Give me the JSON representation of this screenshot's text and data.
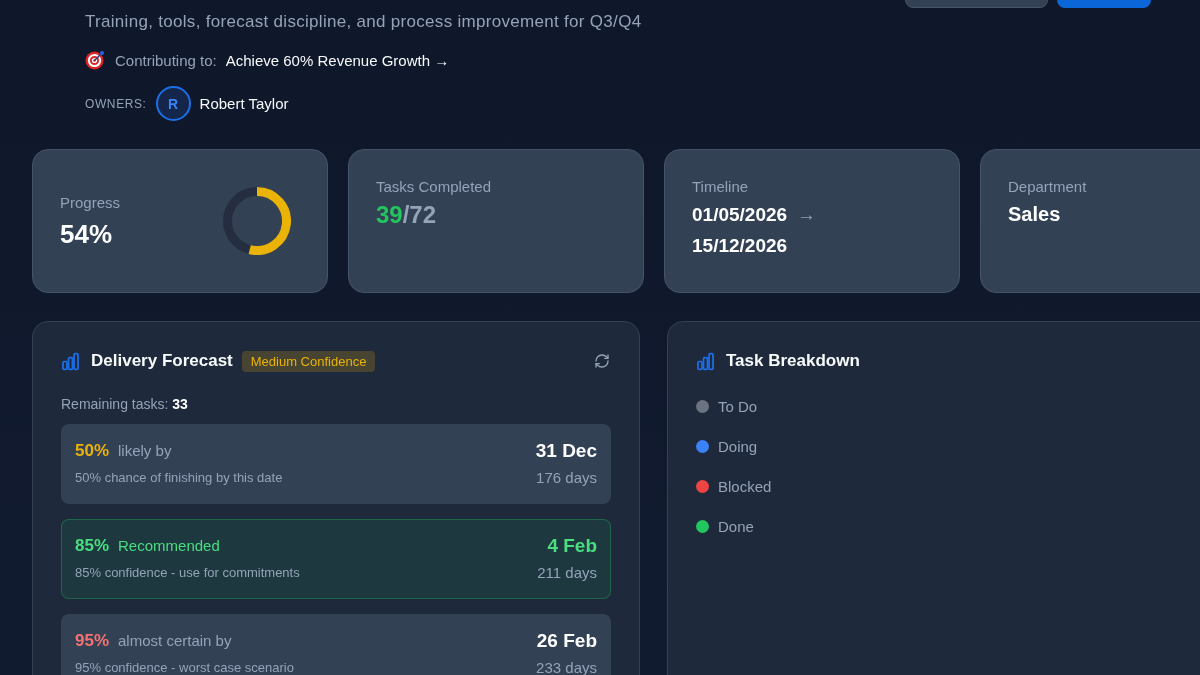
{
  "header_buttons": [
    {
      "kind": "secondary"
    },
    {
      "kind": "primary"
    }
  ],
  "description": "Training, tools, forecast discipline, and process improvement for Q3/Q4",
  "contributing": {
    "label": "Contributing to:",
    "goal": "Achieve 60% Revenue Growth →"
  },
  "owners": {
    "label": "OWNERS:",
    "people": [
      {
        "initial": "R",
        "name": "Robert Taylor"
      }
    ]
  },
  "stats": [
    {
      "kind": "progress",
      "label": "Progress",
      "value": "54%",
      "level": 0.54
    },
    {
      "kind": "fraction",
      "label": "Tasks Completed",
      "done": "39",
      "total": "/72"
    },
    {
      "kind": "range",
      "label": "Timeline",
      "start": "01/05/2026",
      "arrow": "→",
      "end": "15/12/2026"
    },
    {
      "kind": "text",
      "label": "Department",
      "value": "Sales"
    }
  ],
  "forecast": {
    "title": "Delivery Forecast",
    "confidence": "Medium Confidence",
    "remaining": "Remaining tasks: **33**",
    "rows": [
      {
        "percent": "50%",
        "color": "#eab308",
        "label": "likely by",
        "note": "50% chance of finishing by this date",
        "date": "31 Dec",
        "days": "176 days",
        "recommended": false
      },
      {
        "percent": "85%",
        "color": "#4ade80",
        "label": "Recommended",
        "note": "85% confidence - use for commitments",
        "date": "4 Feb",
        "days": "211 days",
        "recommended": true
      },
      {
        "percent": "95%",
        "color": "#f87171",
        "label": "almost certain by",
        "note": "95% confidence - worst case scenario",
        "date": "26 Feb",
        "days": "233 days",
        "recommended": false
      }
    ]
  },
  "breakdown": {
    "title": "Task Breakdown",
    "legend": [
      {
        "label": "To Do",
        "color": "#6b7280"
      },
      {
        "label": "Doing",
        "color": "#3b82f6"
      },
      {
        "label": "Blocked",
        "color": "#ef4444"
      },
      {
        "label": "Done",
        "color": "#22c55e"
      }
    ]
  }
}
